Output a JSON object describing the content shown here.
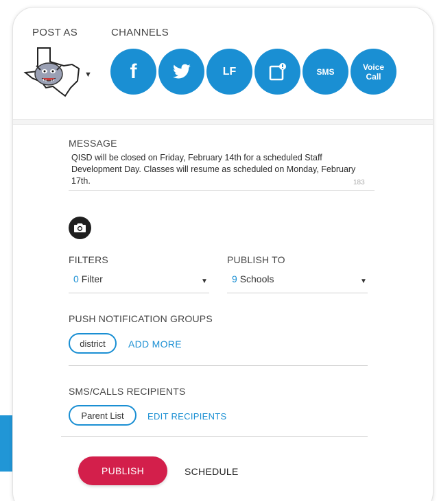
{
  "header": {
    "post_as_label": "POST AS",
    "channels_label": "CHANNELS"
  },
  "channels": [
    {
      "icon": "facebook-icon",
      "label": "f"
    },
    {
      "icon": "twitter-icon",
      "label": ""
    },
    {
      "icon": "lf-icon",
      "label": "LF"
    },
    {
      "icon": "app-notification-icon",
      "label": ""
    },
    {
      "icon": "sms-icon",
      "label": "SMS"
    },
    {
      "icon": "voice-call-icon",
      "label": "Voice Call",
      "label_line1": "Voice",
      "label_line2": "Call"
    }
  ],
  "message": {
    "label": "MESSAGE",
    "text": "QISD will be closed on Friday, February 14th for a scheduled Staff Development Day. Classes will resume as scheduled on Monday, February 17th.",
    "char_count": "183"
  },
  "filters": {
    "label": "FILTERS",
    "count": "0",
    "value": "Filter"
  },
  "publish_to": {
    "label": "PUBLISH TO",
    "count": "9",
    "value": "Schools"
  },
  "push_groups": {
    "label": "PUSH NOTIFICATION GROUPS",
    "chips": [
      "district"
    ],
    "add_more": "ADD MORE"
  },
  "sms_recipients": {
    "label": "SMS/CALLS RECIPIENTS",
    "chips": [
      "Parent List"
    ],
    "edit": "EDIT RECIPIENTS"
  },
  "actions": {
    "publish": "PUBLISH",
    "schedule": "SCHEDULE"
  },
  "colors": {
    "accent": "#1a8fd3",
    "publish": "#d31f4b"
  }
}
